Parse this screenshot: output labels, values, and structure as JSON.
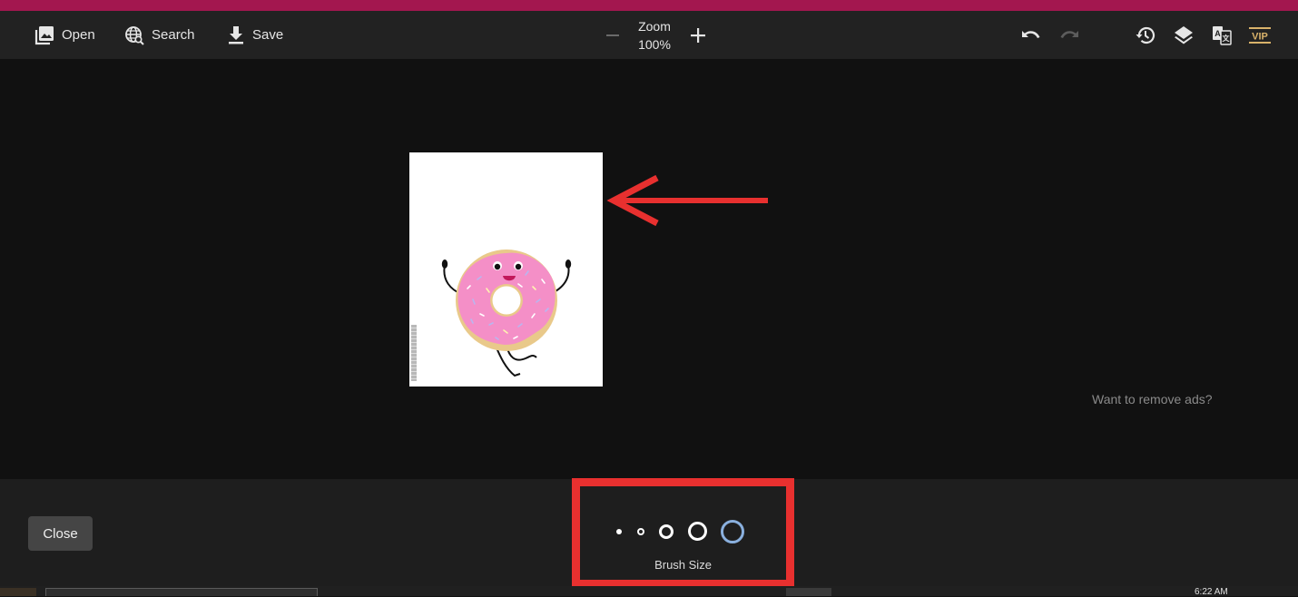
{
  "toolbar": {
    "open_label": "Open",
    "search_label": "Search",
    "save_label": "Save",
    "zoom_label": "Zoom",
    "zoom_value": "100%",
    "icons": {
      "open": "image-stack-icon",
      "search": "globe-search-icon",
      "save": "download-icon",
      "zoom_out": "minus-icon",
      "zoom_in": "plus-icon",
      "undo": "undo-icon",
      "redo": "redo-icon",
      "history": "history-icon",
      "layers": "layers-icon",
      "translate": "translate-icon",
      "vip": "vip-badge"
    },
    "vip_label": "VIP",
    "vip_color": "#d9b26a"
  },
  "canvas": {
    "image_alt": "Cartoon pink donut character dancing",
    "ads_text": "Want to remove ads?",
    "annotation_color": "#e8302f"
  },
  "bottom_panel": {
    "close_label": "Close",
    "brush_label": "Brush Size",
    "brush_sizes": [
      "extra-small",
      "small",
      "medium",
      "large",
      "extra-large"
    ],
    "selected_brush_index": 4,
    "selected_color": "#8ab0de"
  },
  "taskbar": {
    "time": "6:22 AM"
  },
  "colors": {
    "browser_accent": "#a3174f",
    "toolbar_bg": "#222222",
    "canvas_bg": "#111111",
    "panel_bg": "#1e1e1e"
  }
}
